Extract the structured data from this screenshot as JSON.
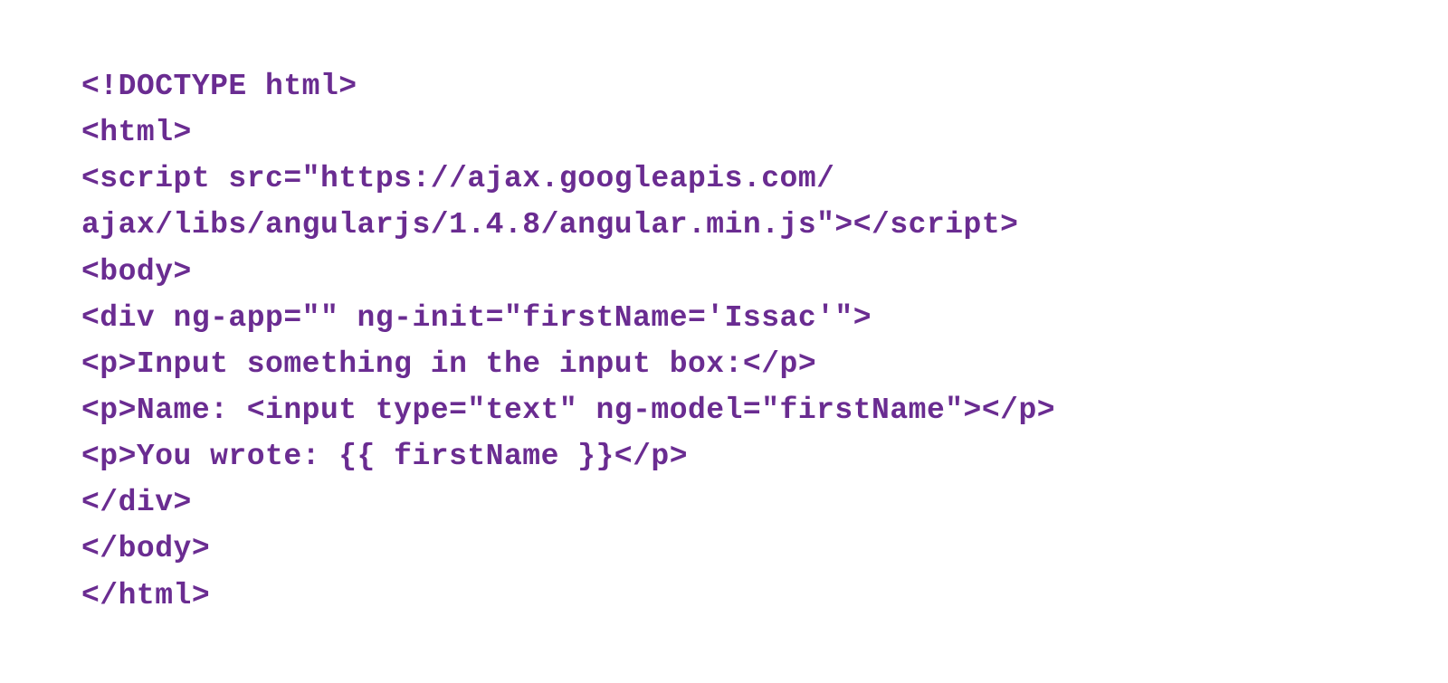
{
  "code": {
    "color": "#6a2c91",
    "lines": [
      "<!DOCTYPE html>",
      "<html>",
      "<script src=\"https://ajax.googleapis.com/",
      "ajax/libs/angularjs/1.4.8/angular.min.js\"></script>",
      "<body>",
      "<div ng-app=\"\" ng-init=\"firstName='Issac'\">",
      "<p>Input something in the input box:</p>",
      "<p>Name: <input type=\"text\" ng-model=\"firstName\"></p>",
      "<p>You wrote: {{ firstName }}</p>",
      "</div>",
      "</body>",
      "</html>"
    ]
  }
}
